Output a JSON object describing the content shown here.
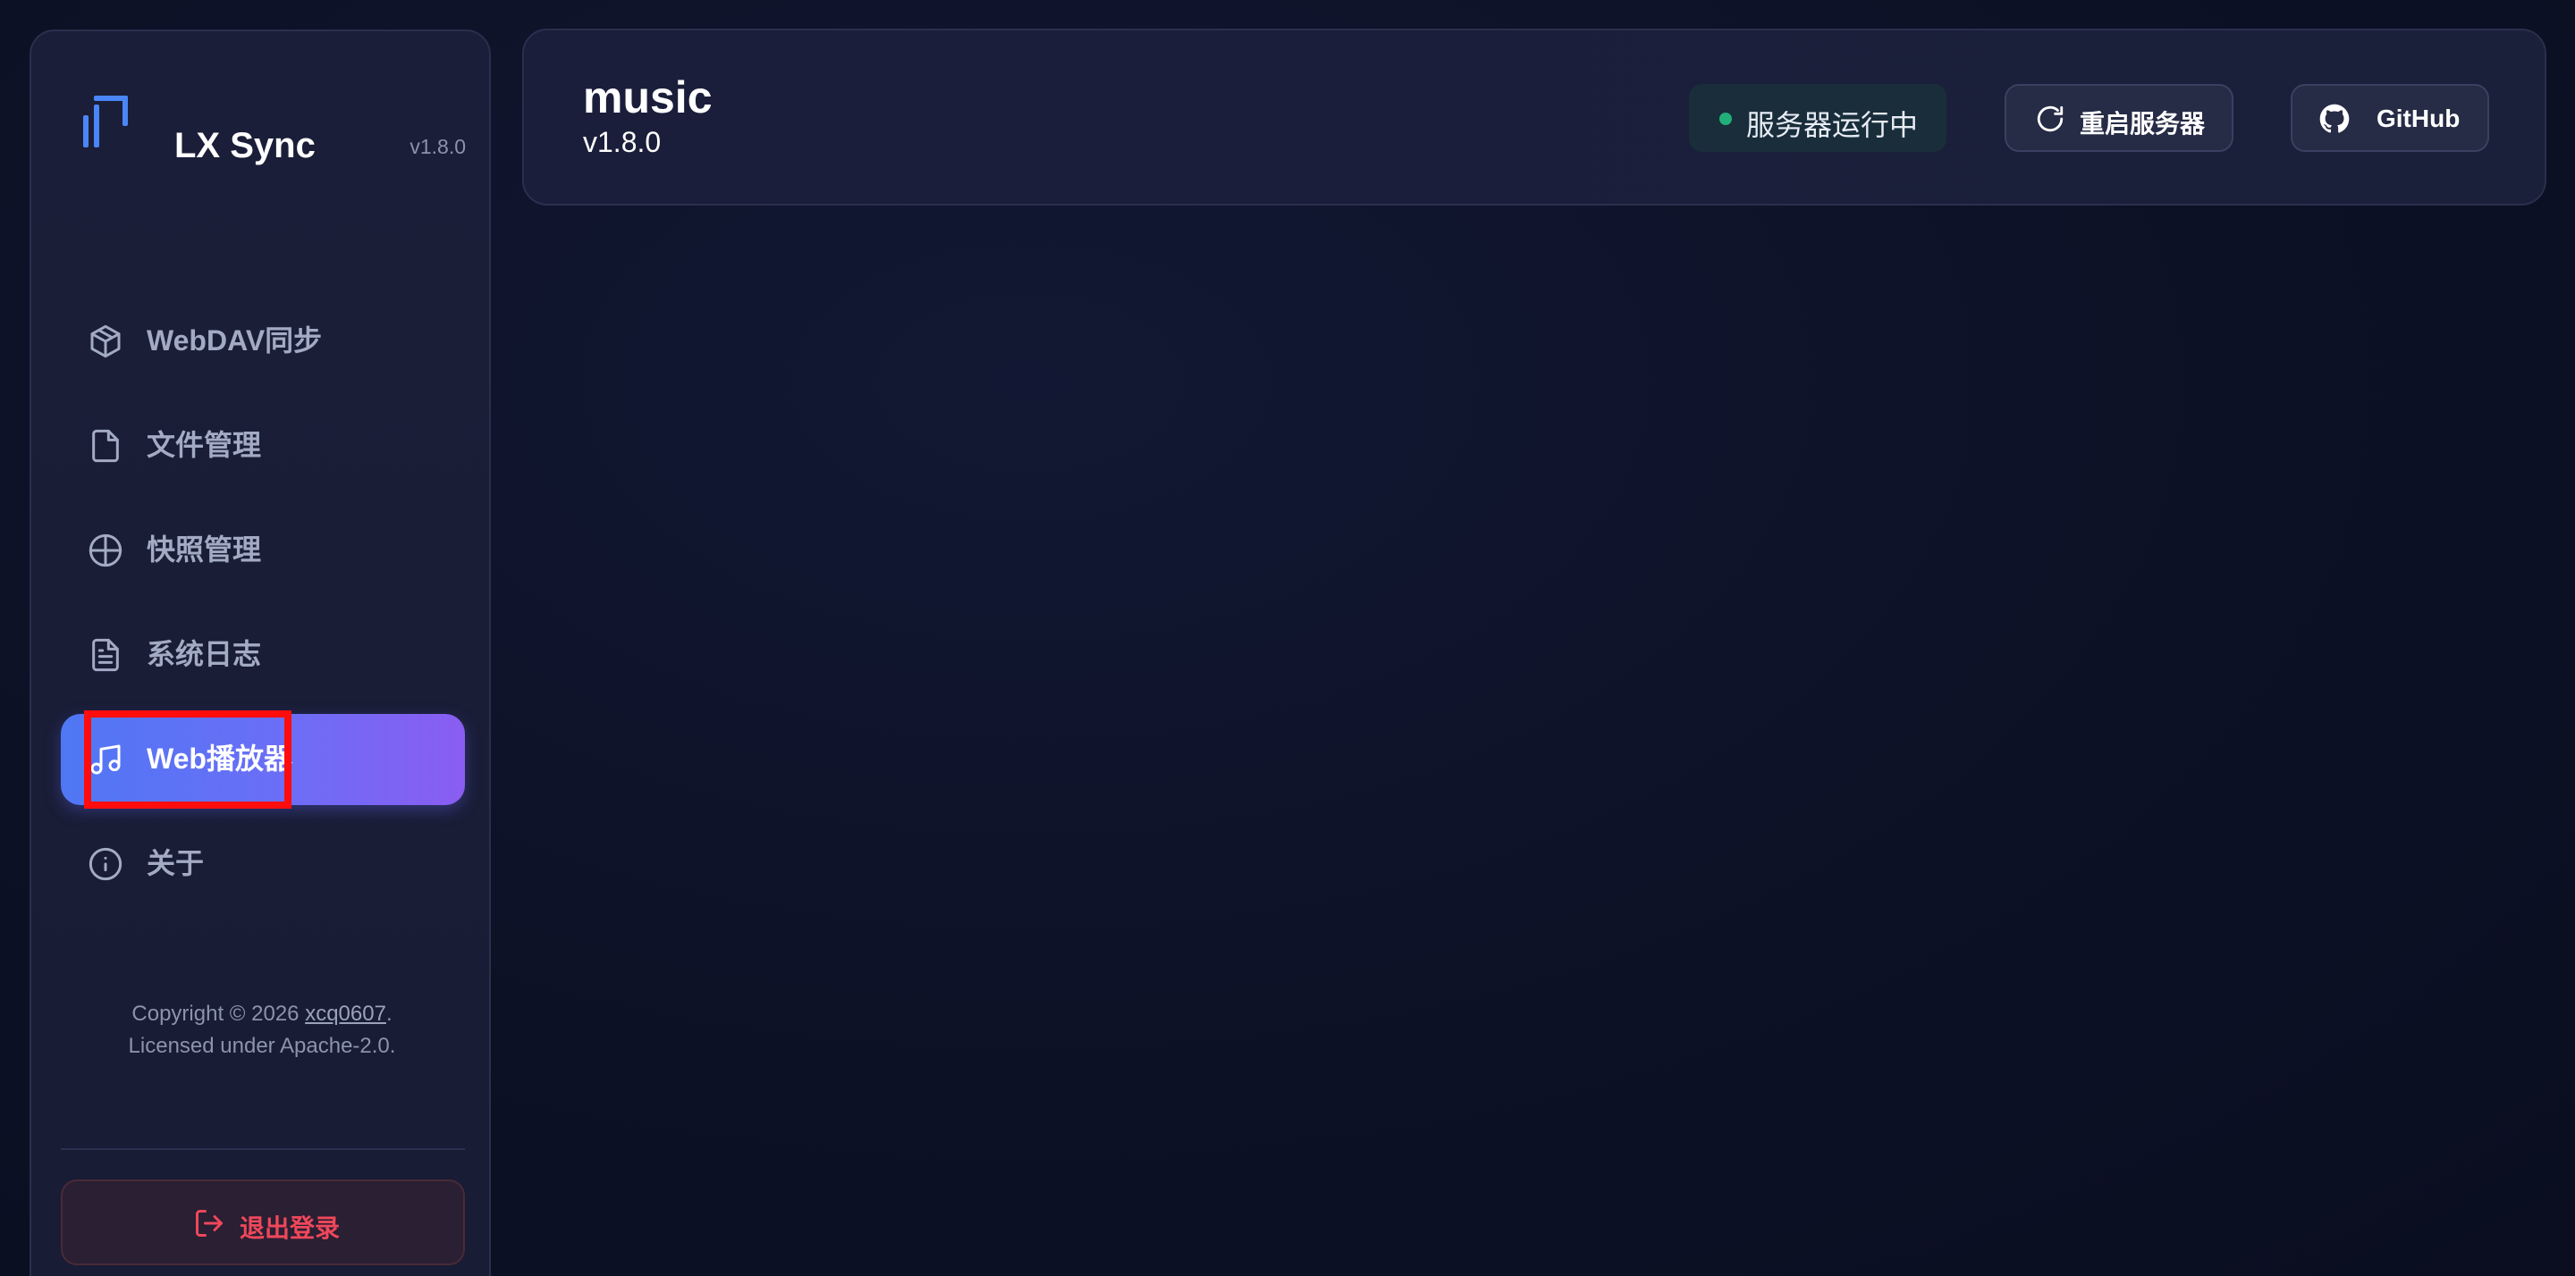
{
  "sidebar": {
    "brand": {
      "title": "LX Sync",
      "version": "v1.8.0",
      "logo_icon": "lx-logo-icon"
    },
    "items": [
      {
        "label": "WebDAV同步",
        "icon": "box-icon",
        "active": false
      },
      {
        "label": "文件管理",
        "icon": "file-icon",
        "active": false
      },
      {
        "label": "快照管理",
        "icon": "crosshair-icon",
        "active": false
      },
      {
        "label": "系统日志",
        "icon": "file-text-icon",
        "active": false
      },
      {
        "label": "Web播放器",
        "icon": "music-icon",
        "active": true
      },
      {
        "label": "关于",
        "icon": "info-icon",
        "active": false
      }
    ],
    "copyright": {
      "prefix": "Copyright © 2026 ",
      "author": "xcq0607",
      "suffix": ".",
      "license": "Licensed under Apache-2.0."
    },
    "logout": {
      "label": "退出登录",
      "icon": "logout-icon"
    }
  },
  "header": {
    "title": "music",
    "version": "v1.8.0",
    "status": {
      "text": "服务器运行中",
      "color": "#22b07a"
    },
    "restart_button": {
      "label": "重启服务器",
      "icon": "refresh-icon"
    },
    "github_button": {
      "label": "GitHub",
      "icon": "github-icon"
    }
  },
  "colors": {
    "accent_gradient_start": "#4f77f4",
    "accent_gradient_end": "#8a5df1",
    "logout": "#f0475a",
    "logo": "#4a86f7",
    "highlight_box": "#ff0d0d"
  }
}
